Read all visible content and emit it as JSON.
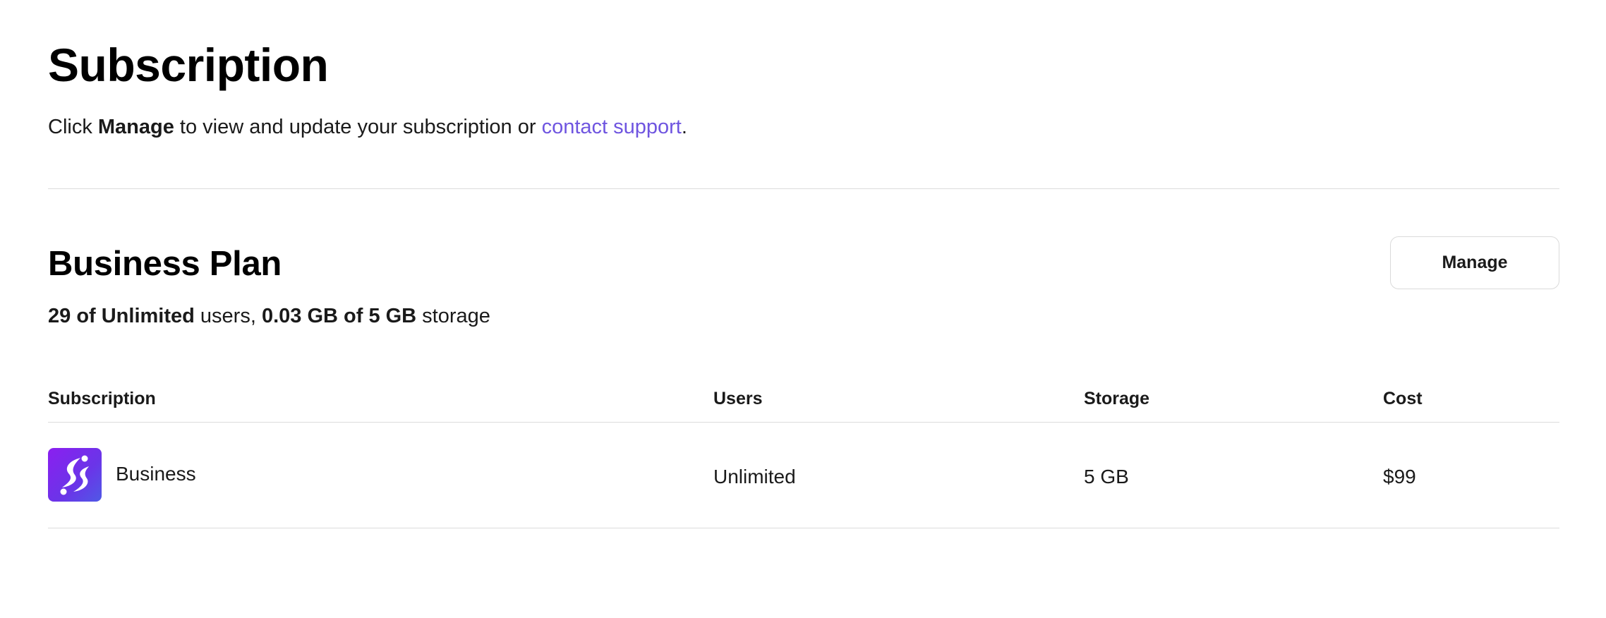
{
  "header": {
    "title": "Subscription",
    "intro_prefix": "Click ",
    "intro_bold": "Manage",
    "intro_middle": " to view and update your subscription or ",
    "intro_link": "contact support",
    "intro_suffix": "."
  },
  "plan": {
    "title": "Business Plan",
    "manage_label": "Manage",
    "users_used": "29 of Unlimited",
    "users_word": " users, ",
    "storage_used": "0.03 GB of 5 GB",
    "storage_word": " storage"
  },
  "table": {
    "columns": [
      "Subscription",
      "Users",
      "Storage",
      "Cost"
    ],
    "rows": [
      {
        "icon": "app-logo-icon",
        "subscription": "Business",
        "users": "Unlimited",
        "storage": "5 GB",
        "cost": "$99"
      }
    ]
  },
  "colors": {
    "link": "#6f55e0",
    "logo_gradient_start": "#8b1ff0",
    "logo_gradient_end": "#4f59e6"
  }
}
